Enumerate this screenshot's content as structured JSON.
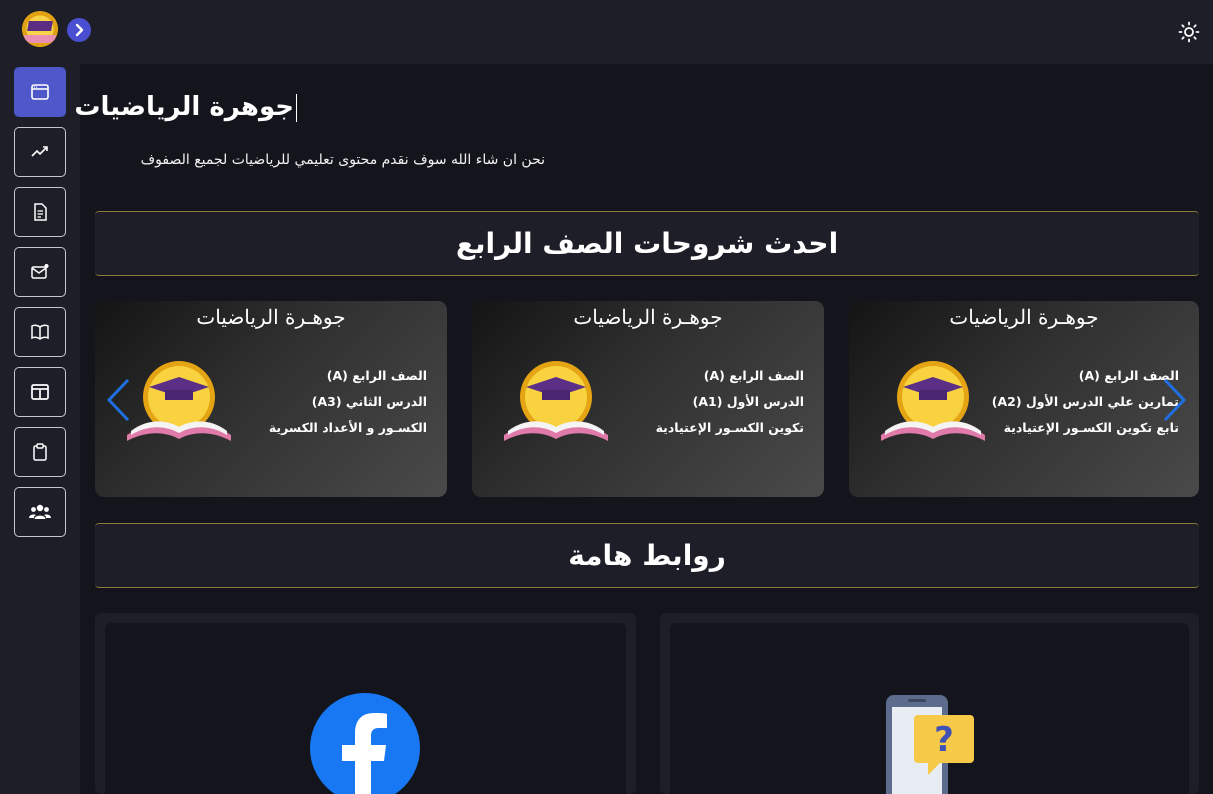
{
  "page": {
    "title": "جوهرة الرياضيات",
    "subtitle": "نحن ان شاء الله سوف نقدم محتوى تعليمي للرياضيات لجميع الصفوف"
  },
  "sections": {
    "latest": "احدث شروحات الصف الرابع",
    "links": "روابط هامة"
  },
  "cards": [
    {
      "brand": "جوهـرة الرياضيات",
      "line1": "الصف الرابع (A)",
      "line2": "الدرس الثاني (A3)",
      "line3": "الكسـور و الأعداد الكسرية"
    },
    {
      "brand": "جوهـرة الرياضيات",
      "line1": "الصف الرابع (A)",
      "line2": "الدرس الأول (A1)",
      "line3": "تكوين الكسـور الإعتيادية"
    },
    {
      "brand": "جوهـرة الرياضيات",
      "line1": "الصف الرابع (A)",
      "line2": "تمارين علي الدرس الأول (A2)",
      "line3": "تابع تكوين الكسـور الإعتيادية"
    }
  ],
  "sidebar_icons": [
    "dashboard-icon",
    "trending-up-icon",
    "document-icon",
    "mail-icon",
    "book-icon",
    "columns-icon",
    "clipboard-icon",
    "users-icon"
  ],
  "links": [
    "facebook-icon",
    "phone-question-icon"
  ],
  "colors": {
    "accent": "#4e58c9",
    "bg": "#14151c",
    "panel": "#1d1e27",
    "gold_border": "#8c7a3a",
    "arrow": "#1f6fe0"
  }
}
